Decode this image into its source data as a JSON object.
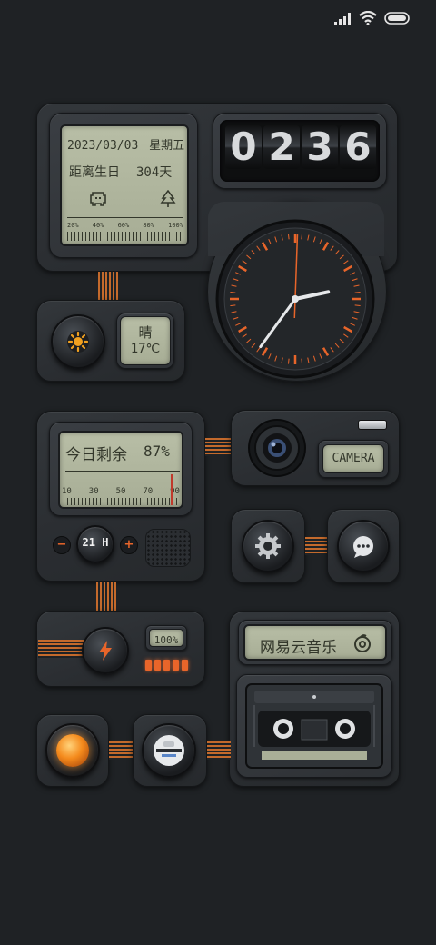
{
  "status_bar": {
    "signal_icon": "signal-bars-icon",
    "wifi_icon": "wifi-icon",
    "battery_icon": "battery-icon"
  },
  "calendar": {
    "date": "2023/03/03",
    "weekday": "星期五",
    "birthday_label": "距离生日",
    "birthday_days": "304天",
    "ruler_labels": [
      "20%",
      "40%",
      "60%",
      "80%",
      "100%"
    ]
  },
  "flip_clock": {
    "digits": [
      "0",
      "2",
      "3",
      "6"
    ]
  },
  "analog_clock": {
    "hour": 2,
    "minute": 36,
    "accent_color": "#e8652a"
  },
  "weather": {
    "condition": "晴",
    "temperature": "17℃"
  },
  "day_progress": {
    "label": "今日剩余",
    "value_text": "87%",
    "percent": 87,
    "ruler_labels": [
      "10",
      "30",
      "50",
      "70",
      "90"
    ],
    "control": {
      "minus": "−",
      "plus": "+",
      "unit": "21 H"
    }
  },
  "camera": {
    "label": "CAMERA"
  },
  "battery_widget": {
    "level_text": "100%",
    "level_percent": 100,
    "bolt_icon": "lightning-bolt-icon"
  },
  "music": {
    "app_name": "网易云音乐",
    "app_icon": "netease-music-icon"
  },
  "colors": {
    "background": "#1f2225",
    "lcd": "#b1b79f",
    "accent": "#e8652a",
    "wire": "#c46a2c"
  }
}
